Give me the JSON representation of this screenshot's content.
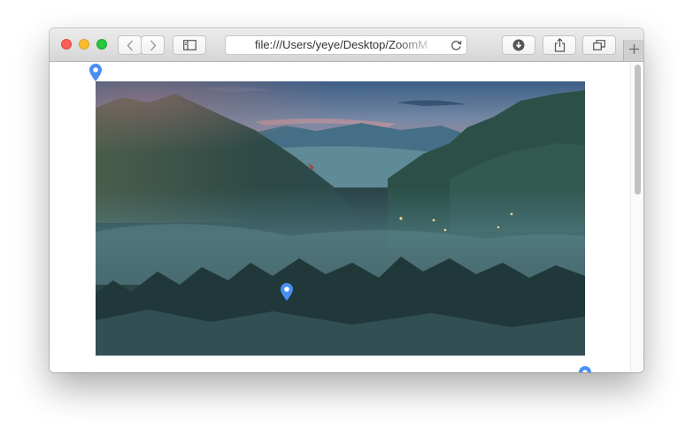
{
  "browser": {
    "url": "file:///Users/yeye/Desktop/ZoomM",
    "icons": {
      "back": "chevron-left-icon",
      "forward": "chevron-right-icon",
      "sidebar": "sidebar-icon",
      "reload": "reload-icon",
      "downloads": "download-icon",
      "share": "share-icon",
      "tabs": "tabs-overview-icon",
      "new_tab": "plus-icon"
    }
  },
  "page": {
    "image": "misty-mountain-valley-dusk-photo",
    "marker_icon": "location-pin-icon",
    "marker_color": "#4a8ef5",
    "marker_count": 3
  },
  "colors": {
    "close": "#fc5f57",
    "minimize": "#fdbc2e",
    "zoom": "#28c840"
  }
}
